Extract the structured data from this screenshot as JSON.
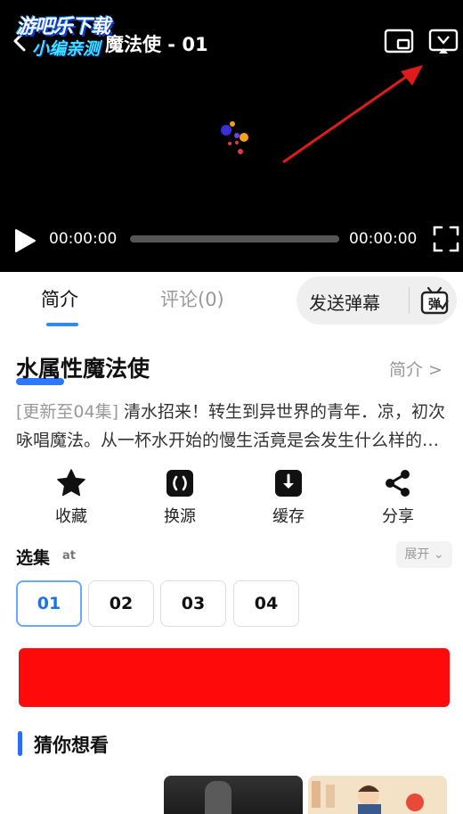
{
  "player": {
    "watermark_line1": "游吧乐下载",
    "watermark_line2": "小编亲测",
    "title": "魔法使 - 01",
    "current_time": "00:00:00",
    "total_time": "00:00:00",
    "progress": 0
  },
  "tabs": {
    "intro": "简介",
    "comments": "评论(0)",
    "active": "简介"
  },
  "danmaku": {
    "label": "发送弹幕",
    "icon_text": "弹"
  },
  "anime": {
    "title": "水属性魔法使",
    "intro_link": "简介 >",
    "update_tag": "[更新至04集]",
    "description": " 清水招来！转生到异世界的青年．凉，初次咏唱魔法。从一杯水开始的慢生活竟是会发生什么样的奇遇呢"
  },
  "actions": [
    {
      "label": "收藏",
      "icon": "star-icon"
    },
    {
      "label": "换源",
      "icon": "switch-source-icon"
    },
    {
      "label": "缓存",
      "icon": "download-icon"
    },
    {
      "label": "分享",
      "icon": "share-icon"
    }
  ],
  "episodes": {
    "heading": "选集",
    "sub": "at",
    "expand": "展开",
    "items": [
      "01",
      "02",
      "03",
      "04"
    ],
    "selected": "01"
  },
  "recommend": {
    "heading": "猜你想看"
  },
  "colors": {
    "accent": "#2d8cf0",
    "banner": "#ff0a0a",
    "player_bg": "#000000",
    "annotation_arrow": "#e01b1b"
  }
}
